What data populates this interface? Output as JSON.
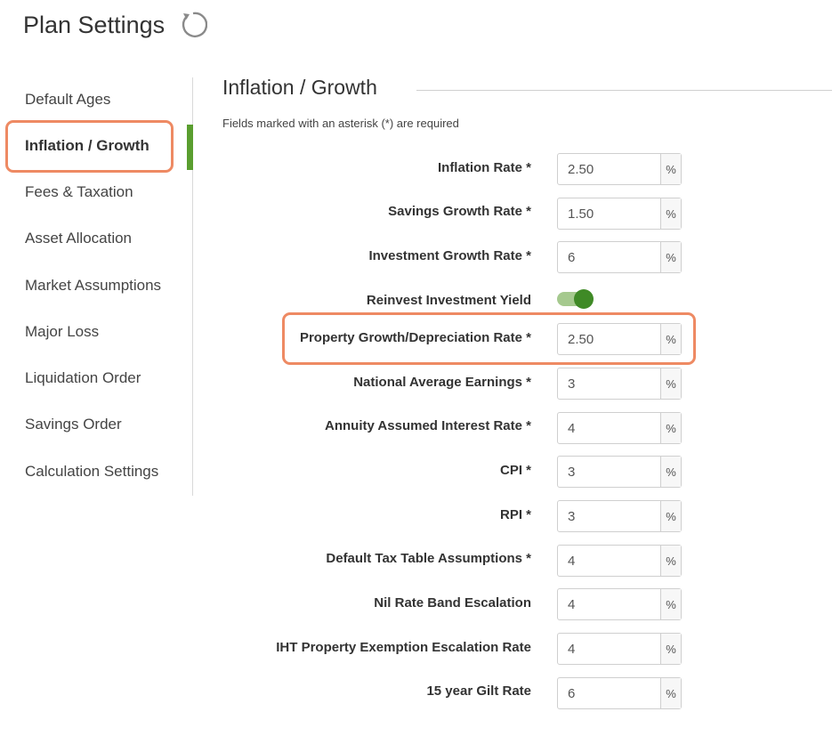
{
  "header": {
    "title": "Plan Settings",
    "refresh_icon": "refresh-icon"
  },
  "sidebar": {
    "items": [
      {
        "label": "Default Ages",
        "active": false
      },
      {
        "label": "Inflation / Growth",
        "active": true
      },
      {
        "label": "Fees & Taxation",
        "active": false
      },
      {
        "label": "Asset Allocation",
        "active": false
      },
      {
        "label": "Market Assumptions",
        "active": false
      },
      {
        "label": "Major Loss",
        "active": false
      },
      {
        "label": "Liquidation Order",
        "active": false
      },
      {
        "label": "Savings Order",
        "active": false
      },
      {
        "label": "Calculation Settings",
        "active": false
      }
    ]
  },
  "section": {
    "title": "Inflation / Growth",
    "required_note": "Fields marked with an asterisk (*) are required"
  },
  "fields": [
    {
      "label": "Inflation Rate *",
      "value": "2.50",
      "unit": "%"
    },
    {
      "label": "Savings Growth Rate *",
      "value": "1.50",
      "unit": "%"
    },
    {
      "label": "Investment Growth Rate *",
      "value": "6",
      "unit": "%"
    },
    {
      "label": "Reinvest Investment Yield",
      "toggle_on": true
    },
    {
      "label": "Property Growth/Depreciation Rate *",
      "value": "2.50",
      "unit": "%"
    },
    {
      "label": "National Average Earnings *",
      "value": "3",
      "unit": "%"
    },
    {
      "label": "Annuity Assumed Interest Rate *",
      "value": "4",
      "unit": "%"
    },
    {
      "label": "CPI *",
      "value": "3",
      "unit": "%"
    },
    {
      "label": "RPI *",
      "value": "3",
      "unit": "%"
    },
    {
      "label": "Default Tax Table Assumptions *",
      "value": "4",
      "unit": "%"
    },
    {
      "label": "Nil Rate Band Escalation",
      "value": "4",
      "unit": "%"
    },
    {
      "label": "IHT Property Exemption Escalation Rate",
      "value": "4",
      "unit": "%"
    },
    {
      "label": "15 year Gilt Rate",
      "value": "6",
      "unit": "%"
    }
  ],
  "colors": {
    "accent_green": "#5a9e2f",
    "highlight_orange": "#ee8a63"
  }
}
